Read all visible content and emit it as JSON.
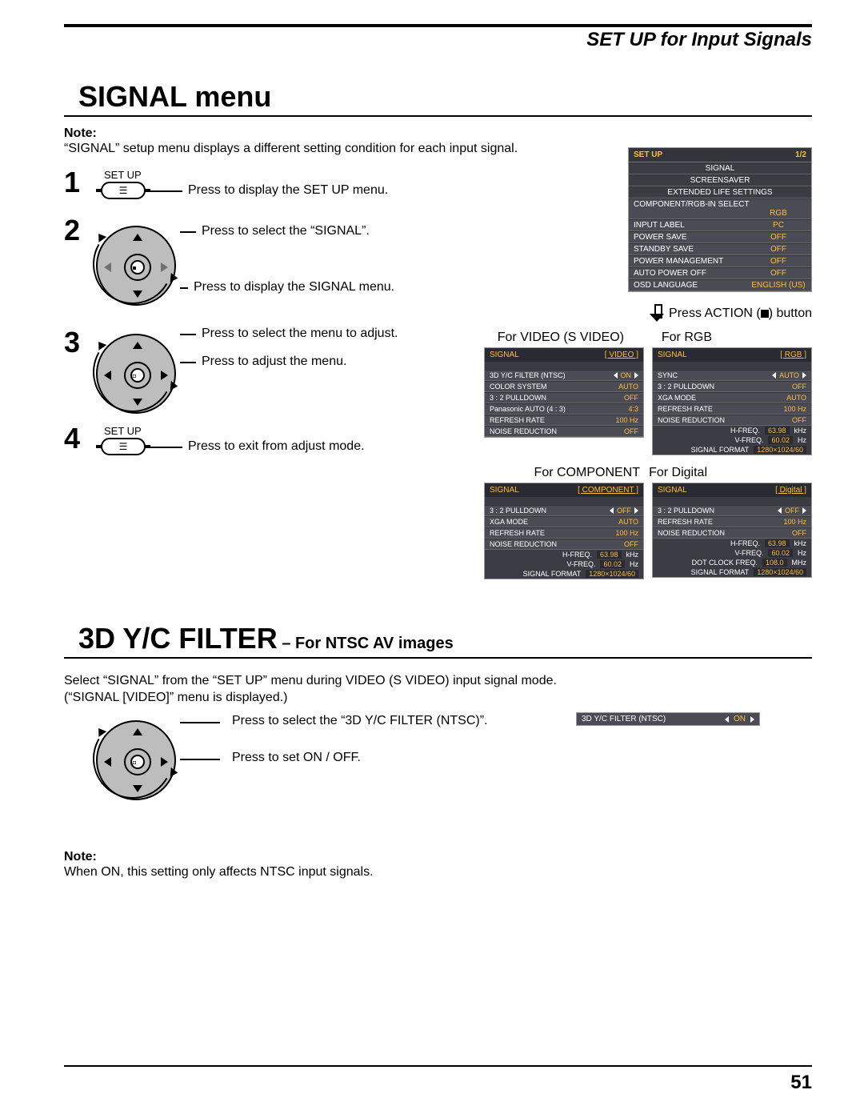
{
  "header": {
    "title": "SET UP for Input Signals"
  },
  "section1": {
    "title": "SIGNAL menu",
    "note_label": "Note:",
    "note_text": "“SIGNAL” setup menu displays a different setting condition for each input signal."
  },
  "steps": {
    "n1": "1",
    "n2": "2",
    "n3": "3",
    "n4": "4",
    "setup_label": "SET UP",
    "s1_text": "Press to display the SET UP menu.",
    "s2_text": "Press to select the “SIGNAL”.",
    "s2b_text": "Press to display the SIGNAL menu.",
    "s3a_text": "Press to select the menu to adjust.",
    "s3b_text": "Press to adjust the menu.",
    "s4_text": "Press to exit from adjust mode."
  },
  "osd_setup": {
    "title": "SET UP",
    "page": "1/2",
    "rows": [
      {
        "label": "SIGNAL"
      },
      {
        "label": "SCREENSAVER"
      },
      {
        "label": "EXTENDED LIFE SETTINGS"
      },
      {
        "label": "COMPONENT/RGB-IN SELECT",
        "value": "RGB"
      },
      {
        "label": "INPUT LABEL",
        "value": "PC"
      },
      {
        "label": "POWER SAVE",
        "value": "OFF"
      },
      {
        "label": "STANDBY SAVE",
        "value": "OFF"
      },
      {
        "label": "POWER MANAGEMENT",
        "value": "OFF"
      },
      {
        "label": "AUTO POWER OFF",
        "value": "OFF"
      },
      {
        "label": "OSD LANGUAGE",
        "value": "ENGLISH (US)"
      }
    ]
  },
  "action_row": {
    "text": "Press ACTION (■) button"
  },
  "sig_labels": {
    "video": "For VIDEO (S VIDEO)",
    "rgb": "For RGB",
    "component": "For COMPONENT",
    "digital": "For Digital"
  },
  "sig_video": {
    "title": "SIGNAL",
    "cat": "[ VIDEO ]",
    "rows": [
      {
        "label": "3D Y/C FILTER (NTSC)",
        "value": "ON",
        "arrows": true
      },
      {
        "label": "COLOR SYSTEM",
        "value": "AUTO"
      },
      {
        "label": "3 : 2 PULLDOWN",
        "value": "OFF"
      },
      {
        "label": "Panasonic AUTO (4 : 3)",
        "value": "4:3"
      },
      {
        "label": "REFRESH RATE",
        "value": "100 Hz"
      },
      {
        "label": "NOISE REDUCTION",
        "value": "OFF"
      }
    ]
  },
  "sig_rgb": {
    "title": "SIGNAL",
    "cat": "[ RGB ]",
    "rows": [
      {
        "label": "SYNC",
        "value": "AUTO",
        "arrows": true
      },
      {
        "label": "3 : 2 PULLDOWN",
        "value": "OFF"
      },
      {
        "label": "XGA MODE",
        "value": "AUTO"
      },
      {
        "label": "REFRESH RATE",
        "value": "100 Hz"
      },
      {
        "label": "NOISE REDUCTION",
        "value": "OFF"
      }
    ],
    "freq": [
      {
        "k": "H-FREQ.",
        "v": "63.98",
        "u": "kHz"
      },
      {
        "k": "V-FREQ.",
        "v": "60.02",
        "u": "Hz"
      }
    ],
    "format": {
      "k": "SIGNAL FORMAT",
      "v": "1280×1024/60"
    }
  },
  "sig_component": {
    "title": "SIGNAL",
    "cat": "[ COMPONENT ]",
    "rows": [
      {
        "label": "3 : 2 PULLDOWN",
        "value": "OFF",
        "arrows": true
      },
      {
        "label": "XGA MODE",
        "value": "AUTO"
      },
      {
        "label": "REFRESH RATE",
        "value": "100 Hz"
      },
      {
        "label": "NOISE REDUCTION",
        "value": "OFF"
      }
    ],
    "freq": [
      {
        "k": "H-FREQ.",
        "v": "63.98",
        "u": "kHz"
      },
      {
        "k": "V-FREQ.",
        "v": "60.02",
        "u": "Hz"
      }
    ],
    "format": {
      "k": "SIGNAL FORMAT",
      "v": "1280×1024/60"
    }
  },
  "sig_digital": {
    "title": "SIGNAL",
    "cat": "[ Digital ]",
    "rows": [
      {
        "label": "3 : 2 PULLDOWN",
        "value": "OFF",
        "arrows": true
      },
      {
        "label": "REFRESH RATE",
        "value": "100 Hz"
      },
      {
        "label": "NOISE REDUCTION",
        "value": "OFF"
      }
    ],
    "freq": [
      {
        "k": "H-FREQ.",
        "v": "63.98",
        "u": "kHz"
      },
      {
        "k": "V-FREQ.",
        "v": "60.02",
        "u": "Hz"
      },
      {
        "k": "DOT CLOCK FREQ.",
        "v": "108.0",
        "u": "MHz"
      }
    ],
    "format": {
      "k": "SIGNAL FORMAT",
      "v": "1280×1024/60"
    }
  },
  "section2": {
    "title_main": "3D Y/C FILTER",
    "title_sub": " – For NTSC AV images",
    "intro_l1": "Select “SIGNAL” from the “SET UP” menu during VIDEO (S VIDEO) input signal mode.",
    "intro_l2": "(“SIGNAL [VIDEO]” menu is displayed.)",
    "line1": "Press to select the “3D Y/C FILTER (NTSC)”.",
    "line2": "Press to set ON / OFF.",
    "osd": {
      "label": "3D Y/C FILTER (NTSC)",
      "value": "ON"
    },
    "note_label": "Note:",
    "note_text": "When ON, this setting only affects NTSC input signals."
  },
  "page_number": "51"
}
